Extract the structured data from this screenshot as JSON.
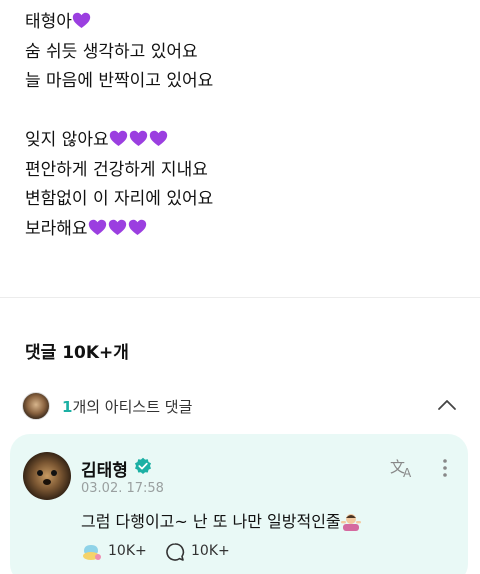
{
  "post": {
    "lines": [
      {
        "text": "태형아",
        "hearts": 1
      },
      {
        "text": "숨 쉬듯 생각하고 있어요",
        "hearts": 0
      },
      {
        "text": "늘 마음에 반짝이고 있어요",
        "hearts": 0
      },
      {
        "text": "",
        "hearts": 0
      },
      {
        "text": "잊지 않아요",
        "hearts": 3
      },
      {
        "text": "편안하게 건강하게 지내요",
        "hearts": 0
      },
      {
        "text": "변함없이 이 자리에 있어요",
        "hearts": 0
      },
      {
        "text": "보라해요",
        "hearts": 3
      }
    ],
    "heart_color": "#9b3fe0"
  },
  "comments": {
    "title": "댓글 10K+개",
    "artist_summary": {
      "count": "1",
      "label": "개의 아티스트 댓글",
      "accent": "#1cb0a4"
    },
    "featured": {
      "author": "김태형",
      "time": "03.02. 17:58",
      "text": "그럼 다행이고~ 난 또 나만 일방적인줄",
      "likes": "10K+",
      "replies": "10K+",
      "card_bg": "#e9f9f6"
    }
  }
}
